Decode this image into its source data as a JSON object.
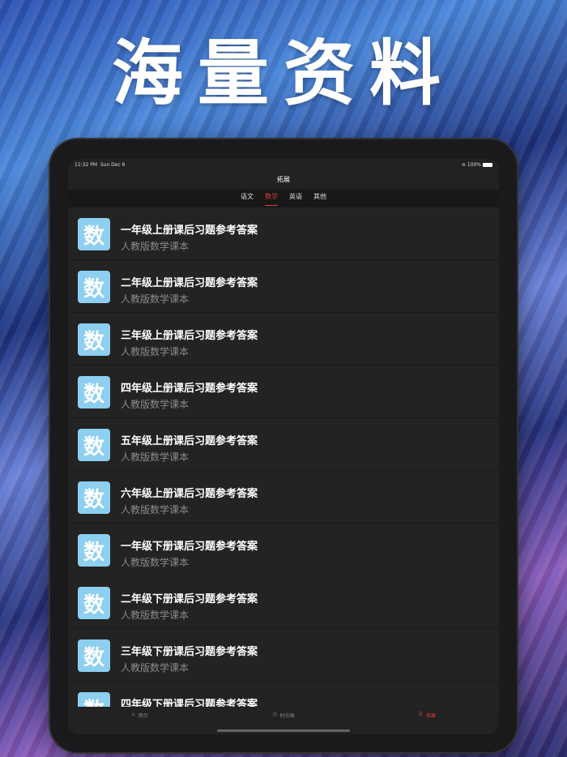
{
  "headline": "海量资料",
  "status": {
    "time": "11:32 PM",
    "date": "Sun Dec 6",
    "battery": "100%"
  },
  "nav_title": "拓展",
  "tabs": [
    {
      "label": "语文"
    },
    {
      "label": "数学",
      "active": true
    },
    {
      "label": "英语"
    },
    {
      "label": "其他"
    }
  ],
  "icon_char": "数",
  "items": [
    {
      "title": "一年级上册课后习题参考答案",
      "subtitle": "人教版数学课本"
    },
    {
      "title": "二年级上册课后习题参考答案",
      "subtitle": "人教版数学课本"
    },
    {
      "title": "三年级上册课后习题参考答案",
      "subtitle": "人教版数学课本"
    },
    {
      "title": "四年级上册课后习题参考答案",
      "subtitle": "人教版数学课本"
    },
    {
      "title": "五年级上册课后习题参考答案",
      "subtitle": "人教版数学课本"
    },
    {
      "title": "六年级上册课后习题参考答案",
      "subtitle": "人教版数学课本"
    },
    {
      "title": "一年级下册课后习题参考答案",
      "subtitle": "人教版数学课本"
    },
    {
      "title": "二年级下册课后习题参考答案",
      "subtitle": "人教版数学课本"
    },
    {
      "title": "三年级下册课后习题参考答案",
      "subtitle": "人教版数学课本"
    },
    {
      "title": "四年级下册课后习题参考答案",
      "subtitle": "人教版数学课本"
    }
  ],
  "tabbar": [
    {
      "label": "首页",
      "icon": "home-icon"
    },
    {
      "label": "时光轴",
      "icon": "clock-icon"
    },
    {
      "label": "拓展",
      "icon": "list-icon",
      "active": true
    }
  ],
  "colors": {
    "accent": "#e03a3a",
    "icon_bg": "#8dcff0"
  }
}
